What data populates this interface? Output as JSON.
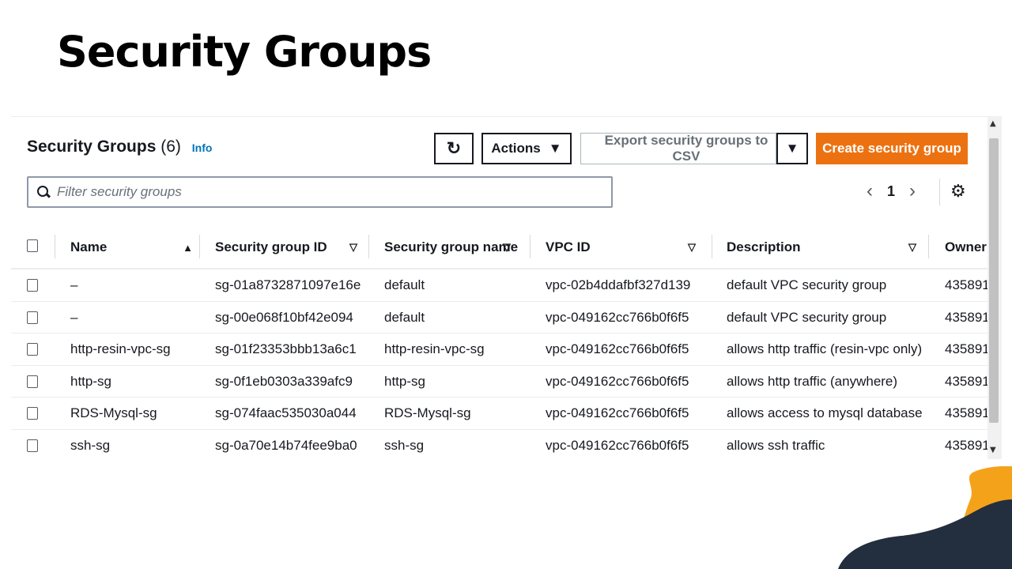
{
  "slide": {
    "title": "Security Groups"
  },
  "header": {
    "title": "Security Groups",
    "count": "(6)",
    "info": "Info"
  },
  "toolbar": {
    "refresh_icon": "refresh-icon",
    "actions_label": "Actions",
    "export_label": "Export security groups to CSV",
    "create_label": "Create security group"
  },
  "filter": {
    "placeholder": "Filter security groups",
    "value": ""
  },
  "pagination": {
    "prev": "‹",
    "page": "1",
    "next": "›"
  },
  "table": {
    "columns": [
      "Name",
      "Security group ID",
      "Security group name",
      "VPC ID",
      "Description",
      "Owner"
    ],
    "rows": [
      {
        "name": "–",
        "id": "sg-01a8732871097e16e",
        "group_name": "default",
        "vpc_id": "vpc-02b4ddafbf327d139",
        "description": "default VPC security group",
        "owner": "435891"
      },
      {
        "name": "–",
        "id": "sg-00e068f10bf42e094",
        "group_name": "default",
        "vpc_id": "vpc-049162cc766b0f6f5",
        "description": "default VPC security group",
        "owner": "435891"
      },
      {
        "name": "http-resin-vpc-sg",
        "id": "sg-01f23353bbb13a6c1",
        "group_name": "http-resin-vpc-sg",
        "vpc_id": "vpc-049162cc766b0f6f5",
        "description": "allows http traffic (resin-vpc only)",
        "owner": "435891"
      },
      {
        "name": "http-sg",
        "id": "sg-0f1eb0303a339afc9",
        "group_name": "http-sg",
        "vpc_id": "vpc-049162cc766b0f6f5",
        "description": "allows http traffic (anywhere)",
        "owner": "435891"
      },
      {
        "name": "RDS-Mysql-sg",
        "id": "sg-074faac535030a044",
        "group_name": "RDS-Mysql-sg",
        "vpc_id": "vpc-049162cc766b0f6f5",
        "description": "allows access to mysql database",
        "owner": "435891"
      },
      {
        "name": "ssh-sg",
        "id": "sg-0a70e14b74fee9ba0",
        "group_name": "ssh-sg",
        "vpc_id": "vpc-049162cc766b0f6f5",
        "description": "allows ssh traffic",
        "owner": "435891"
      }
    ]
  },
  "colors": {
    "accent": "#ec7211",
    "link": "#0073bb",
    "deco_orange": "#f5a21b",
    "deco_navy": "#232f3e"
  }
}
